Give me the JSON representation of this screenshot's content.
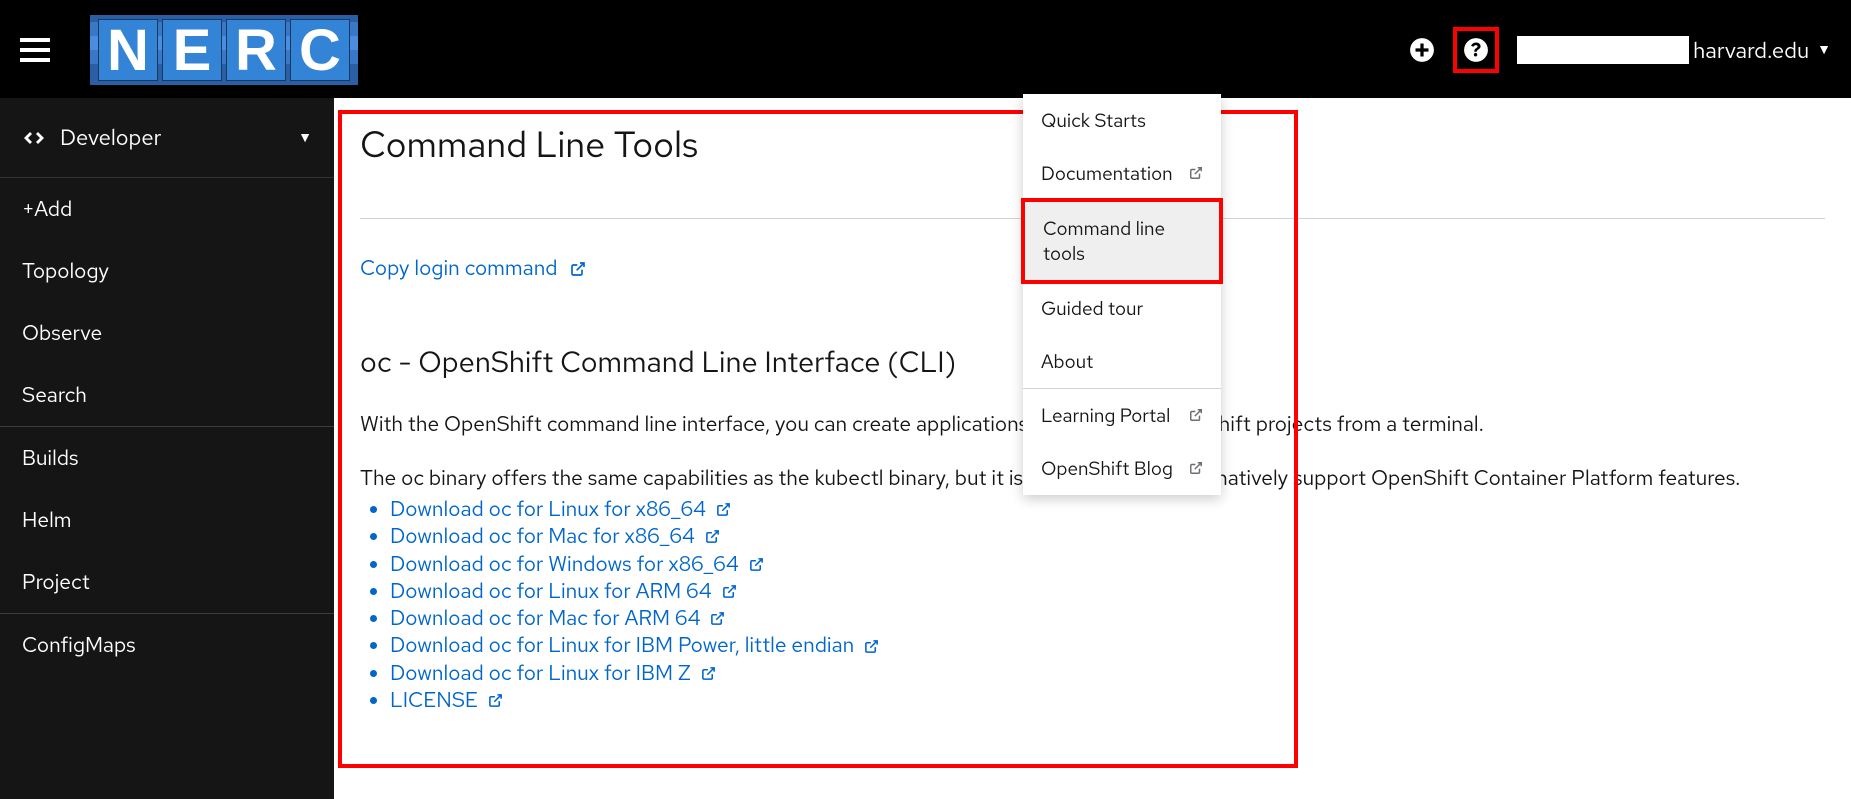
{
  "header": {
    "logo_letters": [
      "N",
      "E",
      "R",
      "C"
    ],
    "user_suffix": "harvard.edu"
  },
  "sidebar": {
    "perspective": "Developer",
    "items": [
      "+Add",
      "Topology",
      "Observe",
      "Search",
      "Builds",
      "Helm",
      "Project",
      "ConfigMaps"
    ]
  },
  "page": {
    "title": "Command Line Tools",
    "copy_login": "Copy login command",
    "section_heading": "oc - OpenShift Command Line Interface (CLI)",
    "para1": "With the OpenShift command line interface, you can create applications and manage OpenShift projects from a terminal.",
    "para2": "The oc binary offers the same capabilities as the kubectl binary, but it is further extended to natively support OpenShift Container Platform features.",
    "links": [
      "Download oc for Linux for x86_64",
      "Download oc for Mac for x86_64",
      "Download oc for Windows for x86_64",
      "Download oc for Linux for ARM 64",
      "Download oc for Mac for ARM 64",
      "Download oc for Linux for IBM Power, little endian",
      "Download oc for Linux for IBM Z",
      "LICENSE"
    ]
  },
  "help_menu": {
    "items": [
      {
        "label": "Quick Starts",
        "ext": false
      },
      {
        "label": "Documentation",
        "ext": true
      },
      {
        "label": "Command line tools",
        "ext": false,
        "highlight": true
      },
      {
        "label": "Guided tour",
        "ext": false
      },
      {
        "label": "About",
        "ext": false
      },
      {
        "label": "Learning Portal",
        "ext": true,
        "sep": true
      },
      {
        "label": "OpenShift Blog",
        "ext": true
      }
    ]
  }
}
